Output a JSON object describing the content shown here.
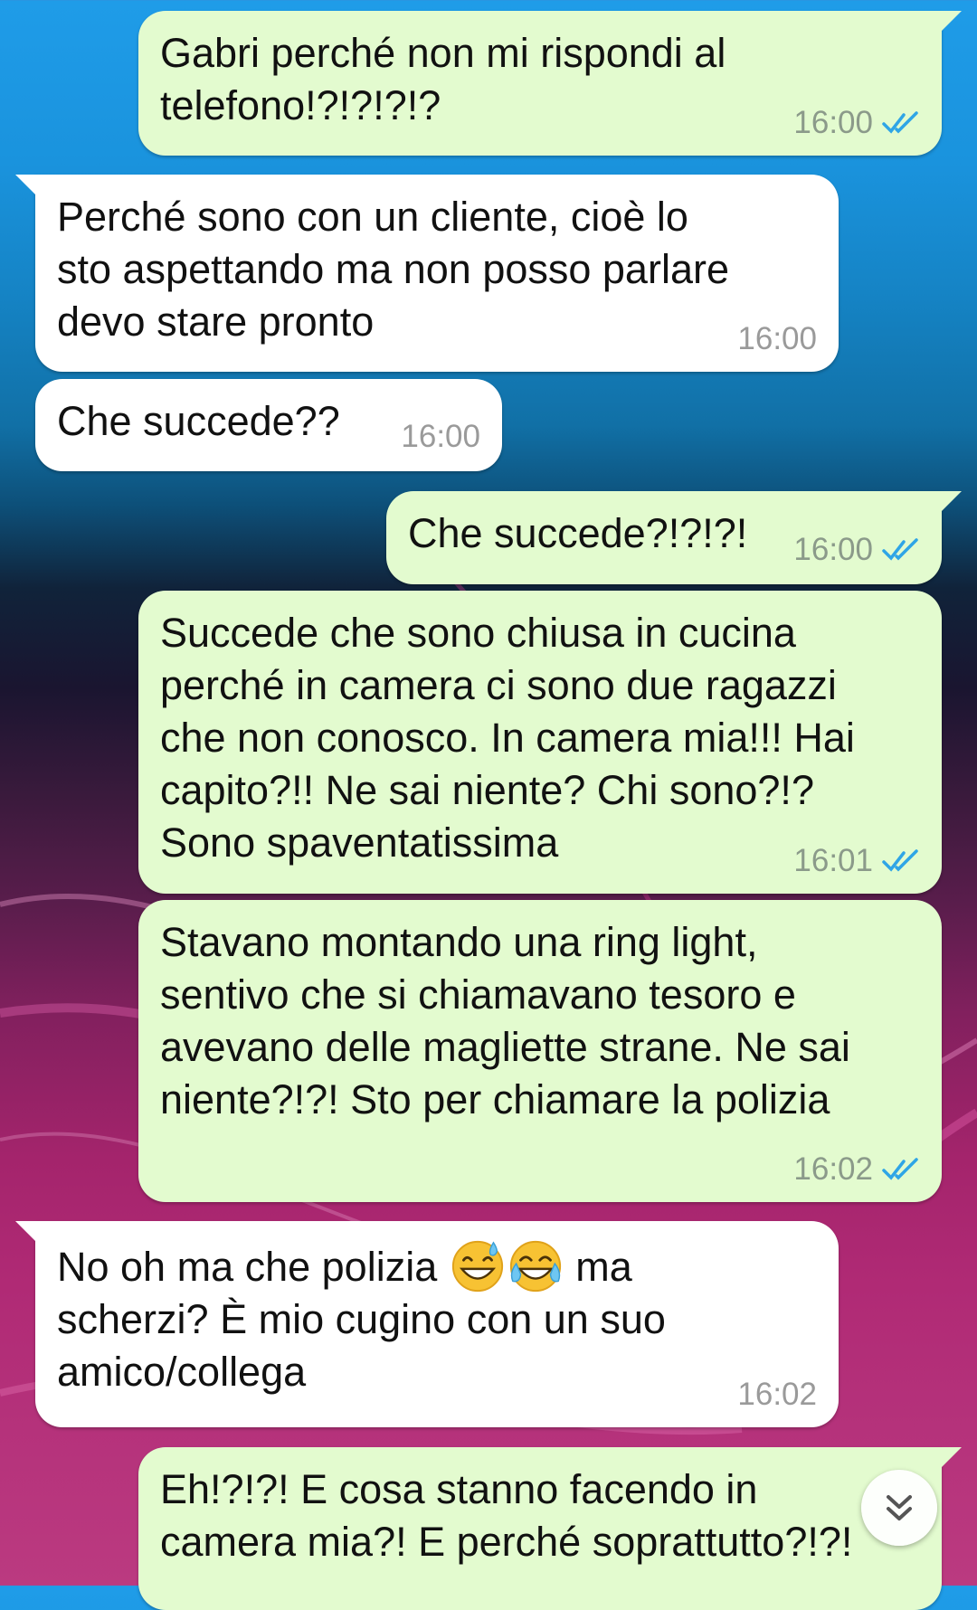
{
  "chat": {
    "messages": [
      {
        "direction": "outgoing",
        "text": "Gabri perché non mi rispondi al\ntelefono!?!?!?!?",
        "time": "16:00",
        "status": "read"
      },
      {
        "direction": "incoming",
        "text": "Perché sono con un cliente, cioè lo\nsto aspettando ma non posso parlare\ndevo stare pronto",
        "time": "16:00"
      },
      {
        "direction": "incoming",
        "text": "Che succede??",
        "time": "16:00"
      },
      {
        "direction": "outgoing",
        "text": "Che succede?!?!?!",
        "time": "16:00",
        "status": "read"
      },
      {
        "direction": "outgoing",
        "text": "Succede che sono chiusa in cucina\nperché in camera ci sono due ragazzi\nche non conosco. In camera mia!!! Hai\ncapito?!! Ne sai niente? Chi sono?!?\nSono spaventatissima",
        "time": "16:01",
        "status": "read"
      },
      {
        "direction": "outgoing",
        "text": "Stavano montando una ring light,\nsentivo che si chiamavano tesoro e\navevano delle magliette strane. Ne sai\nniente?!?! Sto per chiamare la polizia",
        "time": "16:02",
        "status": "read"
      },
      {
        "direction": "incoming",
        "text_line1_before": "No oh ma che polizia ",
        "emoji_1": "grinning-face-with-sweat-icon",
        "emoji_2": "face-with-tears-of-joy-icon",
        "text_line1_after": " ma",
        "text_rest": "scherzi? È mio cugino con un suo\namico/collega",
        "time": "16:02"
      },
      {
        "direction": "outgoing",
        "text": "Eh!?!?! E cosa stanno facendo in\ncamera mia?! E perché soprattutto?!?!",
        "time": "",
        "status": ""
      }
    ],
    "scroll_button_icon": "double-chevron-down-icon"
  },
  "colors": {
    "outgoing_bubble": "#e3fbcf",
    "incoming_bubble": "#ffffff",
    "read_ticks": "#2fa5e6",
    "timestamp": "#8b9a8a"
  }
}
